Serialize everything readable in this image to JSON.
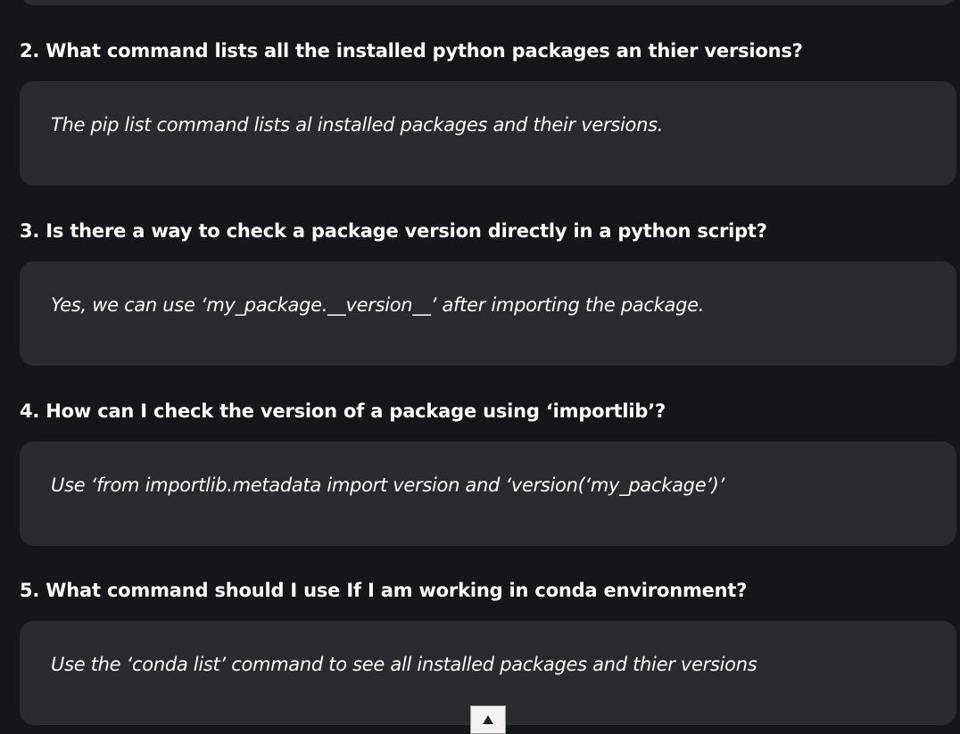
{
  "faq": [
    {
      "question": "2. What command lists all the installed python packages an thier versions?",
      "answer": "The pip list command lists al installed packages and their versions."
    },
    {
      "question": "3. Is there a way to check a package version directly in a python script?",
      "answer": "Yes, we can use ‘my_package.__version__’ after importing the package."
    },
    {
      "question": "4. How can I check the version of a package using ‘importlib’?",
      "answer": "Use ‘from importlib.metadata import version and ‘version(‘my_package’)’"
    },
    {
      "question": "5. What command should I use If I am working in conda environment?",
      "answer": "Use the ‘conda list’ command to see all installed packages and thier versions"
    }
  ],
  "scroll_top_icon": "caret-up-icon",
  "colors": {
    "background": "#151619",
    "card": "#2a2b2e",
    "text": "#ffffff"
  }
}
